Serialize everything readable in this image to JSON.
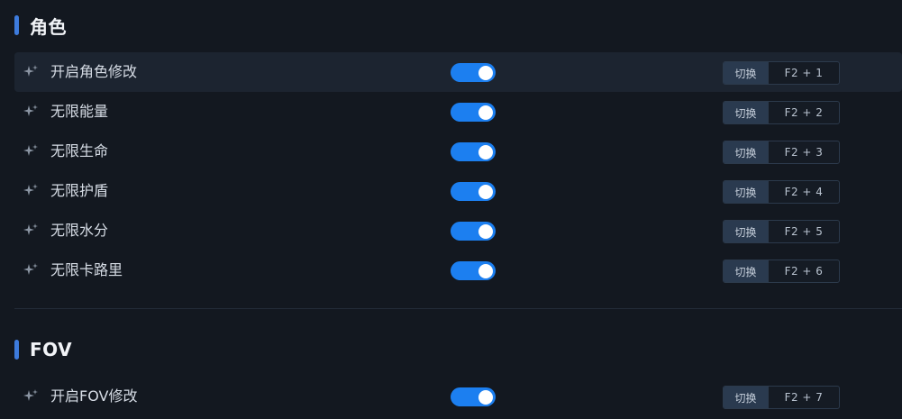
{
  "sections": [
    {
      "title": "角色",
      "items": [
        {
          "label": "开启角色修改",
          "enabled": true,
          "switch_label": "切换",
          "hotkey": "F2 + 1"
        },
        {
          "label": "无限能量",
          "enabled": true,
          "switch_label": "切换",
          "hotkey": "F2 + 2"
        },
        {
          "label": "无限生命",
          "enabled": true,
          "switch_label": "切换",
          "hotkey": "F2 + 3"
        },
        {
          "label": "无限护盾",
          "enabled": true,
          "switch_label": "切换",
          "hotkey": "F2 + 4"
        },
        {
          "label": "无限水分",
          "enabled": true,
          "switch_label": "切换",
          "hotkey": "F2 + 5"
        },
        {
          "label": "无限卡路里",
          "enabled": true,
          "switch_label": "切换",
          "hotkey": "F2 + 6"
        }
      ]
    },
    {
      "title": "FOV",
      "items": [
        {
          "label": "开启FOV修改",
          "enabled": true,
          "switch_label": "切换",
          "hotkey": "F2 + 7"
        }
      ]
    }
  ],
  "colors": {
    "background": "#131820",
    "accent": "#3d7bdd",
    "toggle_on": "#1c7ff0",
    "row_highlight": "#1c2430"
  },
  "icons": {
    "item_icon": "sparkle-icon"
  }
}
